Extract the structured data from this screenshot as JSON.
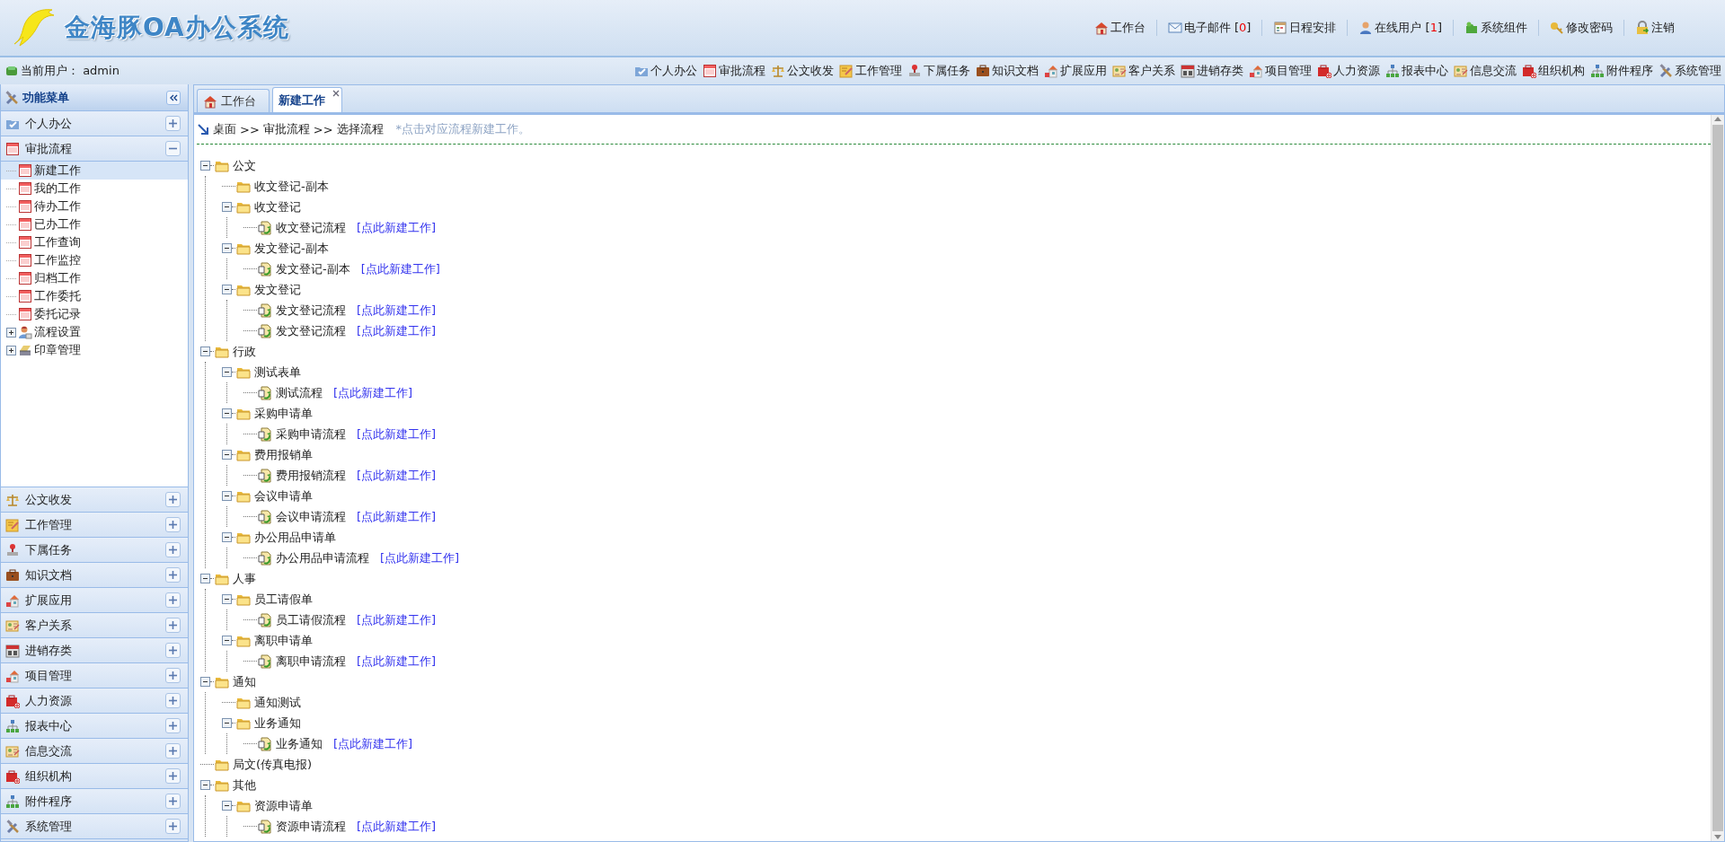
{
  "header": {
    "title": "金海豚OA办公系统",
    "links": [
      {
        "label": "工作台"
      },
      {
        "label": "电子邮件 [",
        "count": "0",
        "suffix": "]"
      },
      {
        "label": "日程安排"
      },
      {
        "label": "在线用户 [",
        "count": "1",
        "suffix": "]"
      },
      {
        "label": "系统组件"
      },
      {
        "label": "修改密码"
      },
      {
        "label": "注销"
      }
    ]
  },
  "user_bar": {
    "current_user": "当前用户： admin",
    "modules": [
      "个人办公",
      "审批流程",
      "公文收发",
      "工作管理",
      "下属任务",
      "知识文档",
      "扩展应用",
      "客户关系",
      "进销存类",
      "项目管理",
      "人力资源",
      "报表中心",
      "信息交流",
      "组织机构",
      "附件程序",
      "系统管理"
    ]
  },
  "sidebar": {
    "title": "功能菜单",
    "sections": [
      {
        "label": "个人办公",
        "expanded": false
      },
      {
        "label": "审批流程",
        "expanded": true,
        "items": [
          {
            "label": "新建工作",
            "kind": "form",
            "selected": true
          },
          {
            "label": "我的工作",
            "kind": "form",
            "selected": false
          },
          {
            "label": "待办工作",
            "kind": "form",
            "selected": false
          },
          {
            "label": "已办工作",
            "kind": "form",
            "selected": false
          },
          {
            "label": "工作查询",
            "kind": "form",
            "selected": false
          },
          {
            "label": "工作监控",
            "kind": "form",
            "selected": false
          },
          {
            "label": "归档工作",
            "kind": "form",
            "selected": false
          },
          {
            "label": "工作委托",
            "kind": "form",
            "selected": false
          },
          {
            "label": "委托记录",
            "kind": "form",
            "selected": false
          },
          {
            "label": "流程设置",
            "kind": "people",
            "selected": false,
            "expanded": false
          },
          {
            "label": "印章管理",
            "kind": "seal",
            "selected": false,
            "expanded": false
          }
        ]
      },
      {
        "label": "公文收发",
        "expanded": false
      },
      {
        "label": "工作管理",
        "expanded": false
      },
      {
        "label": "下属任务",
        "expanded": false
      },
      {
        "label": "知识文档",
        "expanded": false
      },
      {
        "label": "扩展应用",
        "expanded": false
      },
      {
        "label": "客户关系",
        "expanded": false
      },
      {
        "label": "进销存类",
        "expanded": false
      },
      {
        "label": "项目管理",
        "expanded": false
      },
      {
        "label": "人力资源",
        "expanded": false
      },
      {
        "label": "报表中心",
        "expanded": false
      },
      {
        "label": "信息交流",
        "expanded": false
      },
      {
        "label": "组织机构",
        "expanded": false
      },
      {
        "label": "附件程序",
        "expanded": false
      },
      {
        "label": "系统管理",
        "expanded": false
      }
    ]
  },
  "tabs": [
    {
      "label": "工作台",
      "selected": false,
      "closable": false
    },
    {
      "label": "新建工作",
      "selected": true,
      "closable": true
    }
  ],
  "breadcrumb": {
    "items": [
      "桌面",
      "审批流程",
      "选择流程"
    ],
    "separator": ">>",
    "hint": "*点击对应流程新建工作。"
  },
  "tree": [
    {
      "label": "公文",
      "kind": "folder",
      "expanded": true,
      "children": [
        {
          "label": "收文登记-副本",
          "kind": "folder"
        },
        {
          "label": "收文登记",
          "kind": "folder",
          "expanded": true,
          "children": [
            {
              "label": "收文登记流程",
              "kind": "flow",
              "link": "[点此新建工作]"
            }
          ]
        },
        {
          "label": "发文登记-副本",
          "kind": "folder",
          "expanded": true,
          "children": [
            {
              "label": "发文登记-副本",
              "kind": "flow",
              "link": "[点此新建工作]"
            }
          ]
        },
        {
          "label": "发文登记",
          "kind": "folder",
          "expanded": true,
          "children": [
            {
              "label": "发文登记流程",
              "kind": "flow",
              "link": "[点此新建工作]"
            },
            {
              "label": "发文登记流程",
              "kind": "flow",
              "link": "[点此新建工作]"
            }
          ]
        }
      ]
    },
    {
      "label": "行政",
      "kind": "folder",
      "expanded": true,
      "children": [
        {
          "label": "测试表单",
          "kind": "folder",
          "expanded": true,
          "children": [
            {
              "label": "测试流程",
              "kind": "flow",
              "link": "[点此新建工作]"
            }
          ]
        },
        {
          "label": "采购申请单",
          "kind": "folder",
          "expanded": true,
          "children": [
            {
              "label": "采购申请流程",
              "kind": "flow",
              "link": "[点此新建工作]"
            }
          ]
        },
        {
          "label": "费用报销单",
          "kind": "folder",
          "expanded": true,
          "children": [
            {
              "label": "费用报销流程",
              "kind": "flow",
              "link": "[点此新建工作]"
            }
          ]
        },
        {
          "label": "会议申请单",
          "kind": "folder",
          "expanded": true,
          "children": [
            {
              "label": "会议申请流程",
              "kind": "flow",
              "link": "[点此新建工作]"
            }
          ]
        },
        {
          "label": "办公用品申请单",
          "kind": "folder",
          "expanded": true,
          "children": [
            {
              "label": "办公用品申请流程",
              "kind": "flow",
              "link": "[点此新建工作]"
            }
          ]
        }
      ]
    },
    {
      "label": "人事",
      "kind": "folder",
      "expanded": true,
      "children": [
        {
          "label": "员工请假单",
          "kind": "folder",
          "expanded": true,
          "children": [
            {
              "label": "员工请假流程",
              "kind": "flow",
              "link": "[点此新建工作]"
            }
          ]
        },
        {
          "label": "离职申请单",
          "kind": "folder",
          "expanded": true,
          "children": [
            {
              "label": "离职申请流程",
              "kind": "flow",
              "link": "[点此新建工作]"
            }
          ]
        }
      ]
    },
    {
      "label": "通知",
      "kind": "folder",
      "expanded": true,
      "children": [
        {
          "label": "通知测试",
          "kind": "folder"
        },
        {
          "label": "业务通知",
          "kind": "folder",
          "expanded": true,
          "children": [
            {
              "label": "业务通知",
              "kind": "flow",
              "link": "[点此新建工作]"
            }
          ]
        }
      ]
    },
    {
      "label": "局文(传真电报)",
      "kind": "folder"
    },
    {
      "label": "其他",
      "kind": "folder",
      "expanded": true,
      "children": [
        {
          "label": "资源申请单",
          "kind": "folder",
          "expanded": true,
          "children": [
            {
              "label": "资源申请流程",
              "kind": "flow",
              "link": "[点此新建工作]"
            }
          ]
        }
      ]
    }
  ]
}
